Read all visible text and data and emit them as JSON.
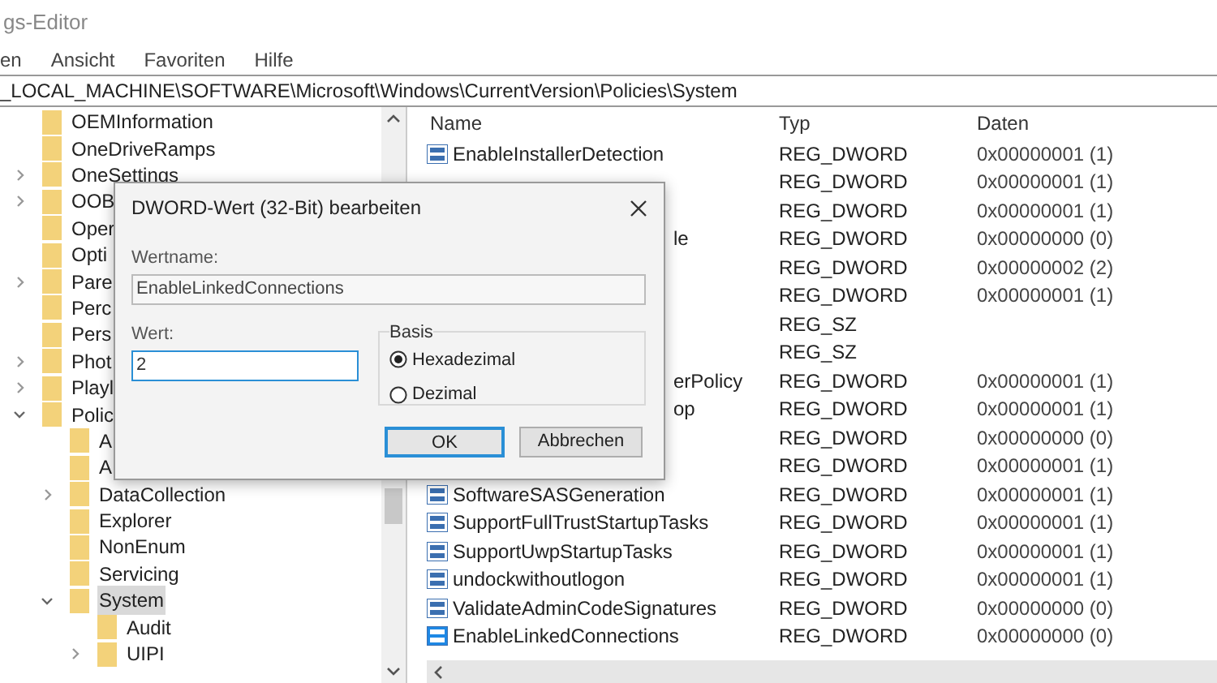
{
  "window": {
    "title": "gs-Editor"
  },
  "menu": [
    "en",
    "Ansicht",
    "Favoriten",
    "Hilfe"
  ],
  "address": "_LOCAL_MACHINE\\SOFTWARE\\Microsoft\\Windows\\CurrentVersion\\Policies\\System",
  "tree": [
    {
      "label": "OEMInformation",
      "selected": false
    },
    {
      "label": "OneDriveRamps",
      "selected": false
    },
    {
      "label": "OneSettings",
      "selected": false,
      "expanded": false
    },
    {
      "label": "OOB",
      "selected": false,
      "expanded": false
    },
    {
      "label": "Oper",
      "selected": false
    },
    {
      "label": "Opti",
      "selected": false
    },
    {
      "label": "Pare",
      "selected": false,
      "expanded": false
    },
    {
      "label": "Perc",
      "selected": false
    },
    {
      "label": "Pers",
      "selected": false
    },
    {
      "label": "Phot",
      "selected": false,
      "expanded": false
    },
    {
      "label": "Playl",
      "selected": false,
      "expanded": false
    },
    {
      "label": "Polic",
      "selected": false,
      "expanded": true,
      "children": [
        {
          "label": "A",
          "selected": false
        },
        {
          "label": "A",
          "selected": false
        },
        {
          "label": "DataCollection",
          "selected": false,
          "expanded": false
        },
        {
          "label": "Explorer",
          "selected": false
        },
        {
          "label": "NonEnum",
          "selected": false
        },
        {
          "label": "Servicing",
          "selected": false
        },
        {
          "label": "System",
          "selected": true,
          "expanded": true,
          "children": [
            {
              "label": "Audit",
              "selected": false
            },
            {
              "label": "UIPI",
              "selected": false,
              "expanded": false
            }
          ]
        }
      ]
    }
  ],
  "table": {
    "columns": [
      "Name",
      "Typ",
      "Daten"
    ],
    "rows": [
      {
        "kind": "full",
        "name": "EnableInstallerDetection",
        "type": "REG_DWORD",
        "data": "0x00000001 (1)",
        "selected": false
      },
      {
        "kind": "hidden",
        "type": "REG_DWORD",
        "data": "0x00000001 (1)",
        "selected": false
      },
      {
        "kind": "hidden",
        "type": "REG_DWORD",
        "data": "0x00000001 (1)",
        "selected": false
      },
      {
        "kind": "partial",
        "name": "le",
        "type": "REG_DWORD",
        "data": "0x00000000 (0)",
        "selected": false
      },
      {
        "kind": "hidden",
        "type": "REG_DWORD",
        "data": "0x00000002 (2)",
        "selected": false
      },
      {
        "kind": "hidden",
        "type": "REG_DWORD",
        "data": "0x00000001 (1)",
        "selected": false
      },
      {
        "kind": "hidden",
        "type": "REG_SZ",
        "selected": false
      },
      {
        "kind": "hidden",
        "type": "REG_SZ",
        "selected": false
      },
      {
        "kind": "partial",
        "name": "erPolicy",
        "type": "REG_DWORD",
        "data": "0x00000001 (1)",
        "selected": false
      },
      {
        "kind": "partial",
        "name": "op",
        "type": "REG_DWORD",
        "data": "0x00000001 (1)",
        "selected": false
      },
      {
        "kind": "hidden",
        "type": "REG_DWORD",
        "data": "0x00000000 (0)",
        "selected": false
      },
      {
        "kind": "hidden",
        "type": "REG_DWORD",
        "data": "0x00000001 (1)",
        "selected": false
      },
      {
        "kind": "full",
        "name": "SoftwareSASGeneration",
        "type": "REG_DWORD",
        "data": "0x00000001 (1)",
        "selected": false
      },
      {
        "kind": "full",
        "name": "SupportFullTrustStartupTasks",
        "type": "REG_DWORD",
        "data": "0x00000001 (1)",
        "selected": false
      },
      {
        "kind": "full",
        "name": "SupportUwpStartupTasks",
        "type": "REG_DWORD",
        "data": "0x00000001 (1)",
        "selected": false
      },
      {
        "kind": "full",
        "name": "undockwithoutlogon",
        "type": "REG_DWORD",
        "data": "0x00000001 (1)",
        "selected": false
      },
      {
        "kind": "full",
        "name": "ValidateAdminCodeSignatures",
        "type": "REG_DWORD",
        "data": "0x00000000 (0)",
        "selected": false
      },
      {
        "kind": "full",
        "name": "EnableLinkedConnections",
        "type": "REG_DWORD",
        "data": "0x00000000 (0)",
        "selected": true
      }
    ]
  },
  "dialog": {
    "title": "DWORD-Wert (32-Bit) bearbeiten",
    "name_label": "Wertname:",
    "name_value": "EnableLinkedConnections",
    "value_label": "Wert:",
    "value": "2",
    "base": {
      "label": "Basis",
      "options": [
        {
          "label": "Hexadezimal",
          "selected": true
        },
        {
          "label": "Dezimal",
          "selected": false
        }
      ]
    },
    "buttons": [
      "OK",
      "Abbrechen"
    ]
  }
}
